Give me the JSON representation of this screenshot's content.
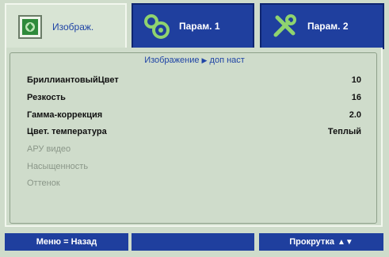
{
  "tabs": [
    {
      "label": "Изображ.",
      "active": true,
      "icon": "image-settings-icon"
    },
    {
      "label": "Парам. 1",
      "active": false,
      "icon": "gears-icon"
    },
    {
      "label": "Парам. 2",
      "active": false,
      "icon": "tools-icon"
    }
  ],
  "breadcrumb": {
    "parent": "Изображение",
    "child": "доп наст"
  },
  "menu": [
    {
      "label": "БриллиантовыйЦвет",
      "value": "10",
      "enabled": true
    },
    {
      "label": "Резкость",
      "value": "16",
      "enabled": true
    },
    {
      "label": "Гамма-коррекция",
      "value": "2.0",
      "enabled": true
    },
    {
      "label": "Цвет. температура",
      "value": "Теплый",
      "enabled": true
    },
    {
      "label": "АРУ видео",
      "value": "",
      "enabled": false
    },
    {
      "label": "Насыщенность",
      "value": "",
      "enabled": false
    },
    {
      "label": "Оттенок",
      "value": "",
      "enabled": false
    }
  ],
  "footer": {
    "menu_back": "Меню = Назад",
    "middle": "",
    "scroll": "Прокрутка",
    "scroll_arrows": "▲▼"
  },
  "colors": {
    "accent_blue": "#1f3f9e",
    "background": "#cfdccb",
    "icon_green": "#2e8a3a"
  }
}
